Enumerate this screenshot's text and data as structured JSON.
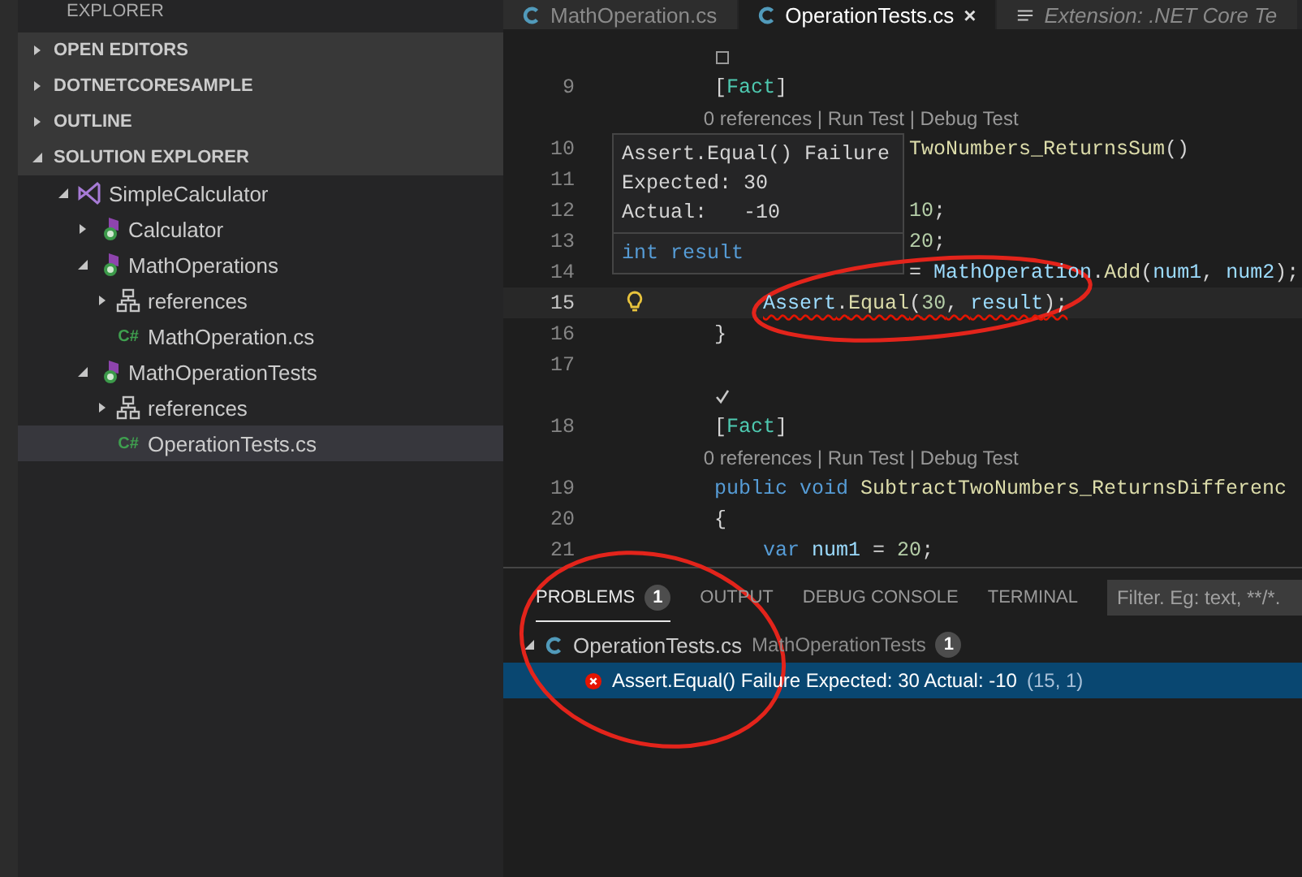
{
  "sidebar": {
    "title": "EXPLORER",
    "sections": [
      {
        "label": "OPEN EDITORS",
        "expanded": false
      },
      {
        "label": "DOTNETCORESAMPLE",
        "expanded": false
      },
      {
        "label": "OUTLINE",
        "expanded": false
      },
      {
        "label": "SOLUTION EXPLORER",
        "expanded": true
      }
    ],
    "tree": [
      {
        "label": "SimpleCalculator",
        "kind": "solution",
        "expanded": true,
        "selected": false,
        "children": [
          {
            "label": "Calculator",
            "kind": "project",
            "expanded": false,
            "selected": false
          },
          {
            "label": "MathOperations",
            "kind": "project",
            "expanded": true,
            "selected": false,
            "children": [
              {
                "label": "references",
                "kind": "references",
                "expanded": false,
                "selected": false
              },
              {
                "label": "MathOperation.cs",
                "kind": "file",
                "icon_text": "C#",
                "selected": false
              }
            ]
          },
          {
            "label": "MathOperationTests",
            "kind": "project",
            "expanded": true,
            "selected": false,
            "children": [
              {
                "label": "references",
                "kind": "references",
                "expanded": false,
                "selected": false
              },
              {
                "label": "OperationTests.cs",
                "kind": "file",
                "icon_text": "C#",
                "selected": true
              }
            ]
          }
        ]
      }
    ]
  },
  "tabs": [
    {
      "label": "MathOperation.cs",
      "kind": "file",
      "selected": false
    },
    {
      "label": "OperationTests.cs",
      "kind": "file",
      "selected": true,
      "close": "×"
    },
    {
      "label": "Extension: .NET Core Te",
      "kind": "preview",
      "selected": false
    }
  ],
  "editor": {
    "lines": [
      {
        "kind": "pending_mark"
      },
      {
        "kind": "code",
        "number": "9",
        "tokens": [
          {
            "text": "        [",
            "kind": "plain"
          },
          {
            "text": "Fact",
            "kind": "type"
          },
          {
            "text": "]",
            "kind": "plain"
          }
        ]
      },
      {
        "kind": "lens",
        "text": "0 references | Run Test | Debug Test"
      },
      {
        "kind": "code",
        "number": "10",
        "tokens": [
          {
            "text": "                        TwoNumbers_ReturnsSum",
            "kind": "method"
          },
          {
            "text": "()",
            "kind": "plain"
          }
        ]
      },
      {
        "kind": "code",
        "number": "11"
      },
      {
        "kind": "code",
        "number": "12",
        "tokens": [
          {
            "text": "                        10",
            "kind": "number"
          },
          {
            "text": ";",
            "kind": "plain"
          }
        ]
      },
      {
        "kind": "code",
        "number": "13",
        "tokens": [
          {
            "text": "                        20",
            "kind": "number"
          },
          {
            "text": ";",
            "kind": "plain"
          }
        ]
      },
      {
        "kind": "code",
        "number": "14",
        "tokens": [
          {
            "text": "                        = ",
            "kind": "plain"
          },
          {
            "text": "MathOperation",
            "kind": "var"
          },
          {
            "text": ".",
            "kind": "plain"
          },
          {
            "text": "Add",
            "kind": "method"
          },
          {
            "text": "(",
            "kind": "plain"
          },
          {
            "text": "num1",
            "kind": "var"
          },
          {
            "text": ", ",
            "kind": "plain"
          },
          {
            "text": "num2",
            "kind": "var"
          },
          {
            "text": ");",
            "kind": "plain"
          }
        ]
      },
      {
        "kind": "code",
        "number": "15",
        "current": true,
        "error": true,
        "tokens": [
          {
            "text": "            Assert",
            "kind": "var"
          },
          {
            "text": ".",
            "kind": "plain"
          },
          {
            "text": "Equal",
            "kind": "method"
          },
          {
            "text": "(",
            "kind": "plain"
          },
          {
            "text": "30",
            "kind": "number"
          },
          {
            "text": ", ",
            "kind": "plain"
          },
          {
            "text": "result",
            "kind": "var"
          },
          {
            "text": ");",
            "kind": "plain"
          }
        ]
      },
      {
        "kind": "code",
        "number": "16",
        "tokens": [
          {
            "text": "        }",
            "kind": "plain"
          }
        ]
      },
      {
        "kind": "code",
        "number": "17"
      },
      {
        "kind": "passed_mark"
      },
      {
        "kind": "code",
        "number": "18",
        "tokens": [
          {
            "text": "        [",
            "kind": "plain"
          },
          {
            "text": "Fact",
            "kind": "type"
          },
          {
            "text": "]",
            "kind": "plain"
          }
        ]
      },
      {
        "kind": "lens",
        "text": "0 references | Run Test | Debug Test"
      },
      {
        "kind": "code",
        "number": "19",
        "tokens": [
          {
            "text": "        public void ",
            "kind": "keyword"
          },
          {
            "text": "SubtractTwoNumbers_ReturnsDifferenc",
            "kind": "method"
          }
        ]
      },
      {
        "kind": "code",
        "number": "20",
        "tokens": [
          {
            "text": "        {",
            "kind": "plain"
          }
        ]
      },
      {
        "kind": "code",
        "number": "21",
        "tokens": [
          {
            "text": "            var ",
            "kind": "keyword"
          },
          {
            "text": "num1",
            "kind": "var"
          },
          {
            "text": " = ",
            "kind": "plain"
          },
          {
            "text": "20",
            "kind": "number"
          },
          {
            "text": ";",
            "kind": "plain"
          }
        ]
      }
    ],
    "hover": {
      "message": [
        "Assert.Equal() Failure",
        "Expected: 30",
        "Actual:   -10"
      ],
      "signature": "int result"
    }
  },
  "panel": {
    "tabs": [
      {
        "label": "PROBLEMS",
        "selected": true,
        "badge": "1"
      },
      {
        "label": "OUTPUT",
        "selected": false
      },
      {
        "label": "DEBUG CONSOLE",
        "selected": false
      },
      {
        "label": "TERMINAL",
        "selected": false
      }
    ],
    "filter": {
      "placeholder": "Filter. Eg: text, **/*."
    },
    "groups": [
      {
        "file": "OperationTests.cs",
        "project": "MathOperationTests",
        "count": "1",
        "expanded": true,
        "problems": [
          {
            "kind": "error",
            "message": "Assert.Equal() Failure Expected: 30 Actual: -10",
            "location": "(15, 1)",
            "selected": true
          }
        ]
      }
    ]
  }
}
